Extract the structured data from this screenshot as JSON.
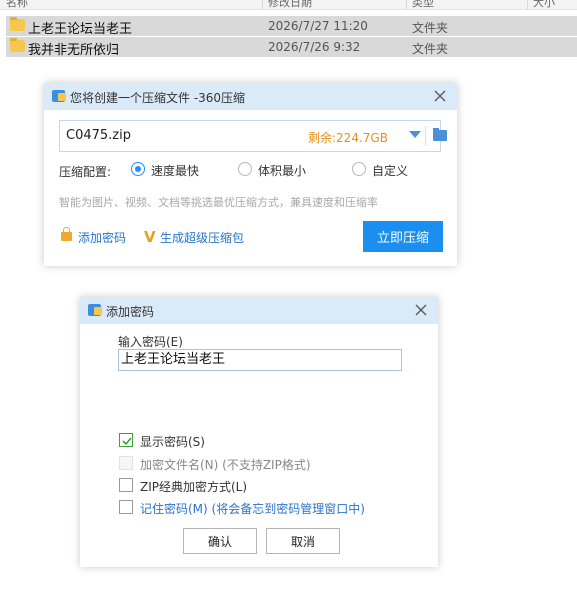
{
  "explorer": {
    "columns": [
      "名称",
      "修改日期",
      "类型",
      "大小"
    ],
    "files": [
      {
        "name": "上老王论坛当老王",
        "date": "2026/7/27 11:20",
        "type": "文件夹"
      },
      {
        "name": "我并非无所依归",
        "date": "2026/7/26 9:32",
        "type": "文件夹"
      }
    ]
  },
  "compress_dialog": {
    "title": "您将创建一个压缩文件 -360压缩",
    "filename": "C0475.zip",
    "free_space": "剩余:224.7GB",
    "level_label": "压缩配置:",
    "options": [
      "速度最快",
      "体积最小",
      "自定义"
    ],
    "selected_option": "速度最快",
    "hint": "智能为图片、视频、文档等挑选最优压缩方式，兼具速度和压缩率",
    "add_password": "添加密码",
    "super_compress": "生成超级压缩包",
    "compress_button": "立即压缩",
    "accent_color": "#1a8ff0"
  },
  "password_dialog": {
    "title": "添加密码",
    "input_label": "输入密码(E)",
    "password_value": "上老王论坛当老王",
    "show_password": {
      "label": "显示密码(S)",
      "checked": true
    },
    "encrypt_filenames": {
      "label": "加密文件名(N) (不支持ZIP格式)",
      "checked": false,
      "disabled": true
    },
    "zip_classic": {
      "label": "ZIP经典加密方式(L)",
      "checked": false
    },
    "remember_password": {
      "label": "记住密码(M) (将会备忘到密码管理窗口中)",
      "checked": false
    },
    "ok_button": "确认",
    "cancel_button": "取消"
  }
}
